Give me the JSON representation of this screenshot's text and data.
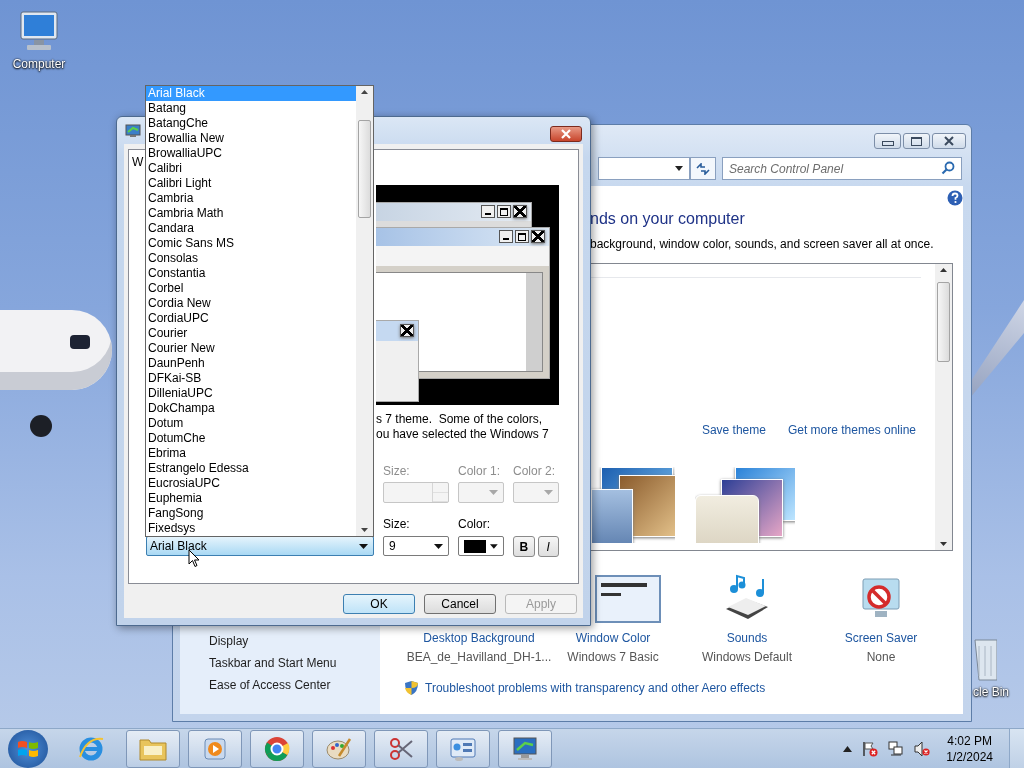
{
  "desktop_icons": [
    {
      "kind": "computer",
      "label": "Computer"
    },
    {
      "kind": "recycle",
      "label": "cle Bin"
    }
  ],
  "control_panel": {
    "search": {
      "placeholder": "Search Control Panel"
    },
    "heading": "nds on your computer",
    "subtext": "background, window color, sounds, and screen saver all at once.",
    "links": [
      "Save theme",
      "Get more themes online"
    ],
    "sidebar": [
      "Display",
      "Taskbar and Start Menu",
      "Ease of Access Center"
    ],
    "settings": [
      {
        "kind": "background",
        "title": "Desktop Background",
        "value": "BEA_de_Havilland_DH-1..."
      },
      {
        "kind": "color",
        "title": "Window Color",
        "value": "Windows 7 Basic"
      },
      {
        "kind": "sounds",
        "title": "Sounds",
        "value": "Windows Default"
      },
      {
        "kind": "saver",
        "title": "Screen Saver",
        "value": "None"
      }
    ],
    "troubleshoot": "Troubleshoot problems with transparency and other Aero effects"
  },
  "dialog": {
    "tab_label": "W",
    "preview_text": [
      "s 7 theme.  Some of the colors,",
      "ou have selected the Windows 7"
    ],
    "item_row": {
      "size_label": "Size:",
      "color1_label": "Color 1:",
      "color2_label": "Color 2:",
      "disabled": true
    },
    "font_row": {
      "font": "Arial Black",
      "size_label": "Size:",
      "size": "9",
      "color_label": "Color:",
      "color": "#000000",
      "bold": "B",
      "italic": "I"
    },
    "font_list": [
      {
        "label": "Arial Black",
        "selected": true
      },
      {
        "label": "Batang",
        "selected": false
      },
      {
        "label": "BatangChe",
        "selected": false
      },
      {
        "label": "Browallia New",
        "selected": false
      },
      {
        "label": "BrowalliaUPC",
        "selected": false
      },
      {
        "label": "Calibri",
        "selected": false
      },
      {
        "label": "Calibri Light",
        "selected": false
      },
      {
        "label": "Cambria",
        "selected": false
      },
      {
        "label": "Cambria Math",
        "selected": false
      },
      {
        "label": "Candara",
        "selected": false
      },
      {
        "label": "Comic Sans MS",
        "selected": false
      },
      {
        "label": "Consolas",
        "selected": false
      },
      {
        "label": "Constantia",
        "selected": false
      },
      {
        "label": "Corbel",
        "selected": false
      },
      {
        "label": "Cordia New",
        "selected": false
      },
      {
        "label": "CordiaUPC",
        "selected": false
      },
      {
        "label": "Courier",
        "selected": false
      },
      {
        "label": "Courier New",
        "selected": false
      },
      {
        "label": "DaunPenh",
        "selected": false
      },
      {
        "label": "DFKai-SB",
        "selected": false
      },
      {
        "label": "DilleniaUPC",
        "selected": false
      },
      {
        "label": "DokChampa",
        "selected": false
      },
      {
        "label": "Dotum",
        "selected": false
      },
      {
        "label": "DotumChe",
        "selected": false
      },
      {
        "label": "Ebrima",
        "selected": false
      },
      {
        "label": "Estrangelo Edessa",
        "selected": false
      },
      {
        "label": "EucrosiaUPC",
        "selected": false
      },
      {
        "label": "Euphemia",
        "selected": false
      },
      {
        "label": "FangSong",
        "selected": false
      },
      {
        "label": "Fixedsys",
        "selected": false
      }
    ],
    "buttons": [
      {
        "label": "OK",
        "kind": "default",
        "disabled": false
      },
      {
        "label": "Cancel",
        "kind": "normal",
        "disabled": false
      },
      {
        "label": "Apply",
        "kind": "normal",
        "disabled": true
      }
    ]
  },
  "taskbar": {
    "items": [
      {
        "kind": "ie",
        "running": false
      },
      {
        "kind": "explorer",
        "running": true
      },
      {
        "kind": "media",
        "running": true
      },
      {
        "kind": "chrome",
        "running": true
      },
      {
        "kind": "paint",
        "running": true
      },
      {
        "kind": "snip",
        "running": true
      },
      {
        "kind": "control",
        "running": true
      },
      {
        "kind": "display",
        "running": true
      }
    ],
    "clock": {
      "time": "4:02 PM",
      "date": "1/2/2024"
    }
  }
}
